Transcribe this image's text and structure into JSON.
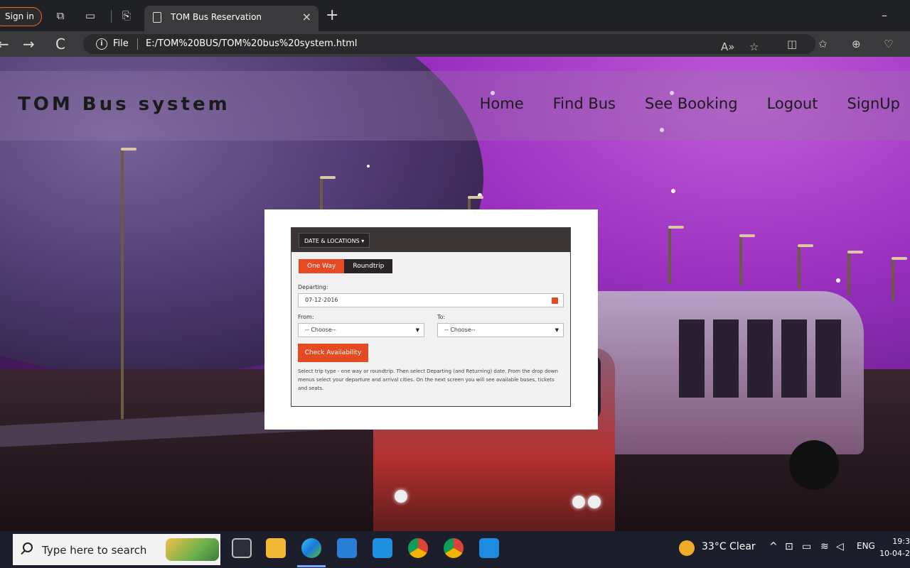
{
  "browser": {
    "signin_label": "Sign in",
    "tab_title": "TOM Bus Reservation",
    "tab_close": "×",
    "new_tab": "+",
    "minimize": "–",
    "back": "←",
    "forward": "→",
    "reload": "C",
    "info": "i",
    "file_label": "File",
    "url": "E:/TOM%20BUS/TOM%20bus%20system.html"
  },
  "site": {
    "brand": "TOM Bus system",
    "nav": [
      "Home",
      "Find Bus",
      "See Booking",
      "Logout",
      "SignUp"
    ]
  },
  "booking": {
    "dropdown_label": "DATE & LOCATIONS ▾",
    "trip_types": [
      "One Way",
      "Roundtrip"
    ],
    "departing_label": "Departing:",
    "departing_value": "07-12-2016",
    "from_label": "From:",
    "to_label": "To:",
    "from_value": "-- Choose--",
    "to_value": "-- Choose--",
    "select_caret": "▼",
    "check_button": "Check Availability",
    "help_text": "Select trip type - one way or roundtrip. Then select Departing (and Returning) date. From the drop down menus select your departure and arrival cities. On the next screen you will see available buses, tickets and seats."
  },
  "taskbar": {
    "search_placeholder": "Type here to search",
    "weather": "33°C  Clear",
    "language": "ENG",
    "time": "19:3",
    "date": "10-04-2"
  },
  "colors": {
    "accent": "#e54a22",
    "panel_dark": "#3b3535",
    "page_purple": "#9a2fbf"
  }
}
